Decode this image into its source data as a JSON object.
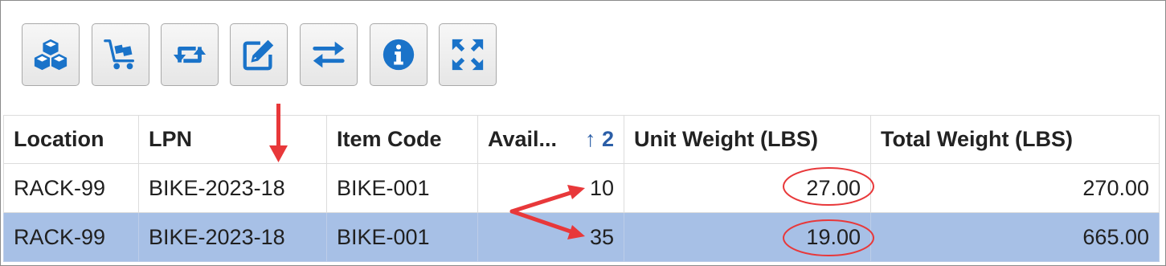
{
  "toolbar": {
    "buttons": [
      {
        "name": "inventory-button",
        "icon": "boxes-icon"
      },
      {
        "name": "cart-button",
        "icon": "cart-icon"
      },
      {
        "name": "transfer-button",
        "icon": "retweet-icon"
      },
      {
        "name": "edit-button",
        "icon": "edit-icon"
      },
      {
        "name": "exchange-button",
        "icon": "exchange-icon"
      },
      {
        "name": "info-button",
        "icon": "info-icon"
      },
      {
        "name": "expand-button",
        "icon": "expand-icon"
      }
    ]
  },
  "grid": {
    "columns": {
      "location": "Location",
      "lpn": "LPN",
      "item_code": "Item Code",
      "available": "Avail...",
      "available_sort": "↑ 2",
      "unit_weight": "Unit Weight (LBS)",
      "total_weight": "Total Weight (LBS)"
    },
    "rows": [
      {
        "location": "RACK-99",
        "lpn": "BIKE-2023-18",
        "item_code": "BIKE-001",
        "available": "10",
        "unit_weight": "27.00",
        "total_weight": "270.00"
      },
      {
        "location": "RACK-99",
        "lpn": "BIKE-2023-18",
        "item_code": "BIKE-001",
        "available": "35",
        "unit_weight": "19.00",
        "total_weight": "665.00"
      }
    ]
  },
  "colors": {
    "accent": "#1a73c9",
    "selected_row": "#a7c0e6",
    "annotation": "#e8383a"
  }
}
